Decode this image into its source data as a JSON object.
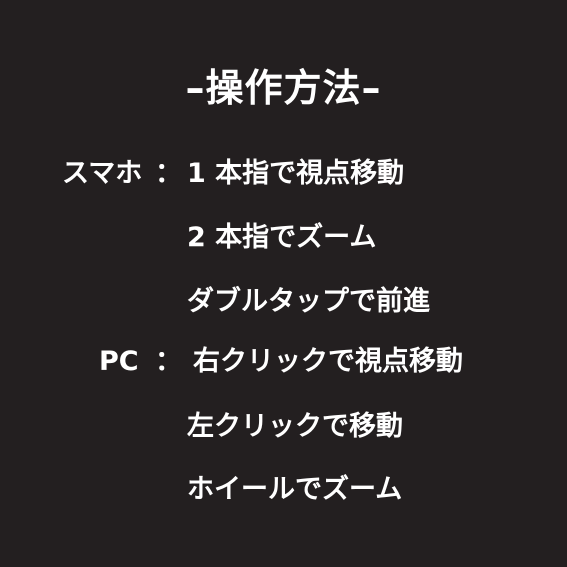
{
  "title": "–操作方法–",
  "smartphone": {
    "label": "スマホ",
    "colon": "：",
    "lines": [
      "1 本指で視点移動",
      "2 本指でズーム",
      "ダブルタップで前進"
    ]
  },
  "pc": {
    "label": "PC",
    "colon": "：",
    "lines": [
      "右クリックで視点移動",
      "左クリックで移動",
      "ホイールでズーム"
    ]
  },
  "colors": {
    "background": "#231f20",
    "text": "#ffffff"
  }
}
